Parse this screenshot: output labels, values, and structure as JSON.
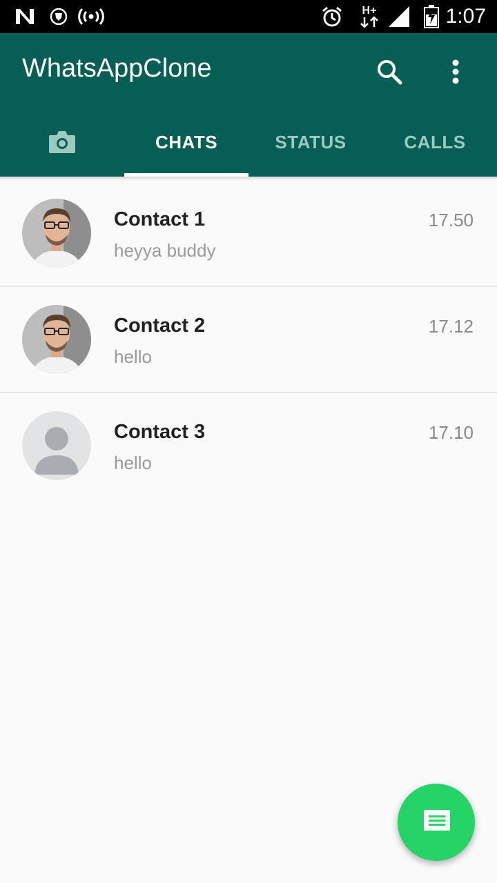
{
  "status_bar": {
    "time": "1:07",
    "network_label": "H+",
    "icons": [
      "n-notification-icon",
      "vpn-shield-icon",
      "hotspot-icon",
      "alarm-icon",
      "network-activity-icon",
      "signal-icon",
      "battery-charging-icon"
    ]
  },
  "app_bar": {
    "title": "WhatsAppClone",
    "background": "#075e54",
    "actions": [
      "search-icon",
      "more-vert-icon"
    ]
  },
  "tabs": {
    "items": [
      {
        "label": "CHATS",
        "active": true
      },
      {
        "label": "STATUS",
        "active": false
      },
      {
        "label": "CALLS",
        "active": false
      }
    ],
    "camera_icon": "camera-icon"
  },
  "chats": [
    {
      "name": "Contact 1",
      "message": "heyya buddy",
      "time": "17.50",
      "avatar": "photo"
    },
    {
      "name": "Contact 2",
      "message": "hello",
      "time": "17.12",
      "avatar": "photo"
    },
    {
      "name": "Contact 3",
      "message": "hello",
      "time": "17.10",
      "avatar": "placeholder"
    }
  ],
  "fab": {
    "icon": "new-chat-message-icon",
    "color": "#25d366"
  }
}
